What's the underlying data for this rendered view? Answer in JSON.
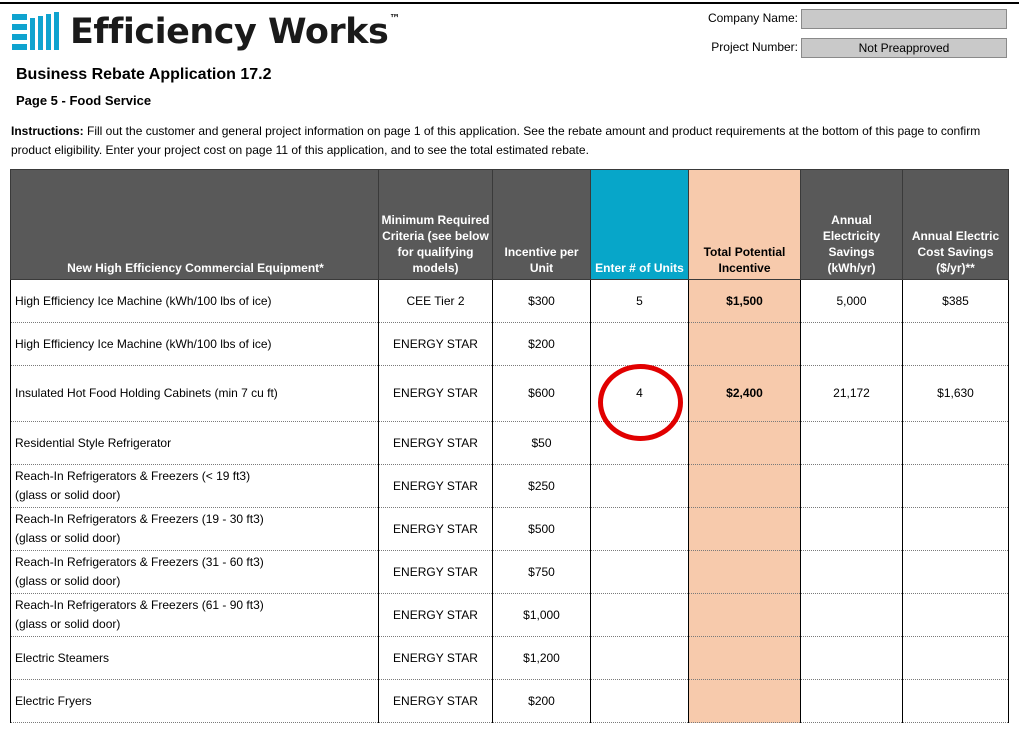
{
  "logo": {
    "text": "Efficiency Works",
    "tm": "™",
    "icon": "efficiency-works-bars-logo",
    "brand_color": "#0fa3cf"
  },
  "header": {
    "company_name_label": "Company Name:",
    "company_name_value": "",
    "project_number_label": "Project Number:",
    "project_number_value": "Not Preapproved"
  },
  "title": "Business Rebate Application 17.2",
  "subtitle": "Page 5 - Food Service",
  "instructions": {
    "label": "Instructions:",
    "text": " Fill out the customer and general project information on page 1 of this application. See the rebate amount and product requirements at the bottom of this page to confirm product eligibility. Enter your project cost on page 11 of this application, and to see the total estimated rebate."
  },
  "table": {
    "headers": [
      "New High Efficiency Commercial Equipment*",
      "Minimum Required Criteria (see below for qualifying models)",
      "Incentive per Unit",
      "Enter # of Units",
      "Total Potential Incentive",
      "Annual Electricity Savings (kWh/yr)",
      "Annual Electric Cost Savings ($/yr)**"
    ],
    "rows": [
      {
        "equipment": "High Efficiency Ice Machine (kWh/100 lbs of ice)",
        "equipment2": "",
        "criteria": "CEE Tier 2",
        "incentive": "$300",
        "units": "5",
        "total": "$1,500",
        "kwh": "5,000",
        "cost": "$385"
      },
      {
        "equipment": "High Efficiency Ice Machine (kWh/100 lbs of ice)",
        "equipment2": "",
        "criteria": "ENERGY STAR",
        "incentive": "$200",
        "units": "",
        "total": "",
        "kwh": "",
        "cost": ""
      },
      {
        "equipment": "Insulated Hot Food Holding Cabinets (min 7 cu ft)",
        "equipment2": "",
        "criteria": "ENERGY STAR",
        "incentive": "$600",
        "units": "4",
        "total": "$2,400",
        "kwh": "21,172",
        "cost": "$1,630"
      },
      {
        "equipment": "Residential Style Refrigerator",
        "equipment2": "",
        "criteria": "ENERGY STAR",
        "incentive": "$50",
        "units": "",
        "total": "",
        "kwh": "",
        "cost": ""
      },
      {
        "equipment": "Reach-In Refrigerators & Freezers (< 19 ft3)",
        "equipment2": "(glass or solid door)",
        "criteria": "ENERGY STAR",
        "incentive": "$250",
        "units": "",
        "total": "",
        "kwh": "",
        "cost": ""
      },
      {
        "equipment": "Reach-In Refrigerators & Freezers (19 - 30 ft3)",
        "equipment2": "(glass or solid door)",
        "criteria": "ENERGY STAR",
        "incentive": "$500",
        "units": "",
        "total": "",
        "kwh": "",
        "cost": ""
      },
      {
        "equipment": "Reach-In Refrigerators & Freezers (31 - 60 ft3)",
        "equipment2": "(glass or solid door)",
        "criteria": "ENERGY STAR",
        "incentive": "$750",
        "units": "",
        "total": "",
        "kwh": "",
        "cost": ""
      },
      {
        "equipment": "Reach-In Refrigerators & Freezers (61 - 90 ft3)",
        "equipment2": "(glass or solid door)",
        "criteria": "ENERGY STAR",
        "incentive": "$1,000",
        "units": "",
        "total": "",
        "kwh": "",
        "cost": ""
      },
      {
        "equipment": "Electric Steamers",
        "equipment2": "",
        "criteria": "ENERGY STAR",
        "incentive": "$1,200",
        "units": "",
        "total": "",
        "kwh": "",
        "cost": ""
      },
      {
        "equipment": "Electric Fryers",
        "equipment2": "",
        "criteria": "ENERGY STAR",
        "incentive": "$200",
        "units": "",
        "total": "",
        "kwh": "",
        "cost": ""
      }
    ]
  },
  "colors": {
    "header_bg": "#595959",
    "units_header_bg": "#07a6c9",
    "total_column_bg": "#f7caac",
    "field_bg": "#c9c9c9",
    "highlight_circle": "#e10000"
  }
}
